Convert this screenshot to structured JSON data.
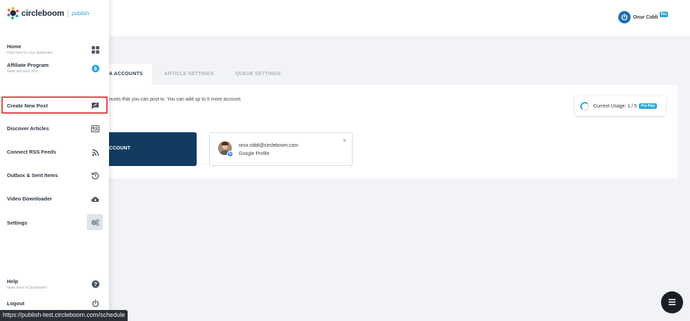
{
  "brand": {
    "name": "circleboom",
    "product": "publish"
  },
  "user": {
    "name": "Onur Ciddi",
    "badge": "Pro"
  },
  "sidebar": {
    "items": [
      {
        "title": "Home",
        "subtitle": "Click here for your dashboard",
        "icon": "dashboard-icon"
      },
      {
        "title": "Affiliate Program",
        "subtitle": "Refer and earn 30%",
        "icon": "dollar-icon"
      },
      {
        "title": "Create New Post",
        "icon": "compose-icon"
      },
      {
        "title": "Discover Articles",
        "icon": "newspaper-icon"
      },
      {
        "title": "Connect RSS Feeds",
        "icon": "rss-icon"
      },
      {
        "title": "Outbox & Sent Items",
        "icon": "history-icon"
      },
      {
        "title": "Video Downloader",
        "icon": "cloud-download-icon"
      },
      {
        "title": "Settings",
        "icon": "gears-icon"
      }
    ],
    "footer": [
      {
        "title": "Help",
        "subtitle": "Make most of Circleboom!",
        "icon": "help-icon"
      },
      {
        "title": "Logout",
        "icon": "power-icon"
      }
    ]
  },
  "tabs": [
    {
      "label": "A ACCOUNTS",
      "active": true
    },
    {
      "label": "ARTICLE SETTINGS",
      "active": false
    },
    {
      "label": "QUEUE SETTINGS",
      "active": false
    }
  ],
  "content": {
    "description": "ounts that you can post to. You can add up to 5 more account.",
    "usage_label": "Current Usage: 1 / 5",
    "usage_badge": "Pro Plan",
    "add_button": "CCOUNT",
    "account": {
      "email": "onur.ciddi@circleboom.com",
      "type": "Google Profile",
      "close": "×"
    }
  },
  "status_bar_url": "https://publish-test.circleboom.com/schedule",
  "colors": {
    "accent": "#29a8df",
    "navy": "#123c5f",
    "highlight": "#e0474c"
  }
}
